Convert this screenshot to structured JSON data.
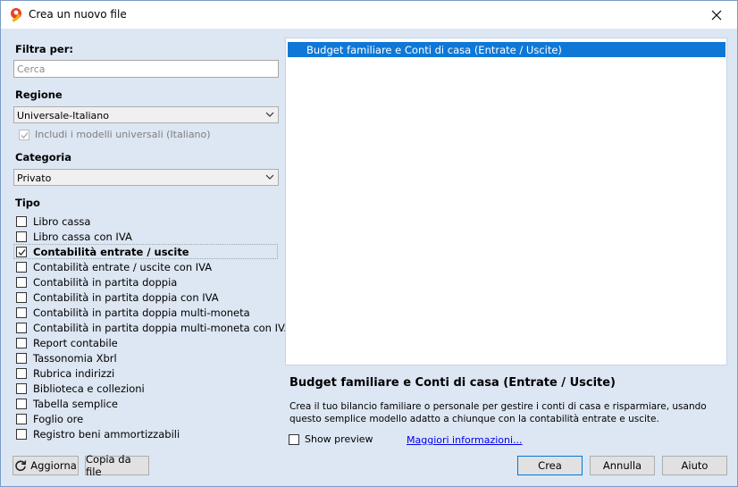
{
  "window": {
    "title": "Crea un nuovo file"
  },
  "filter": {
    "label": "Filtra per:",
    "search_placeholder": "Cerca"
  },
  "region": {
    "label": "Regione",
    "value": "Universale-Italiano",
    "include_universal_label": "Includi i modelli universali (Italiano)",
    "include_universal_checked": true
  },
  "category": {
    "label": "Categoria",
    "value": "Privato"
  },
  "type": {
    "label": "Tipo",
    "items": [
      {
        "label": "Libro cassa",
        "checked": false
      },
      {
        "label": "Libro cassa con IVA",
        "checked": false
      },
      {
        "label": "Contabilità entrate / uscite",
        "checked": true
      },
      {
        "label": "Contabilità entrate / uscite con IVA",
        "checked": false
      },
      {
        "label": "Contabilità in partita doppia",
        "checked": false
      },
      {
        "label": "Contabilità in partita doppia con IVA",
        "checked": false
      },
      {
        "label": "Contabilità in partita doppia multi-moneta",
        "checked": false
      },
      {
        "label": "Contabilità in partita doppia multi-moneta con IVA",
        "checked": false
      },
      {
        "label": "Report contabile",
        "checked": false
      },
      {
        "label": "Tassonomia Xbrl",
        "checked": false
      },
      {
        "label": "Rubrica indirizzi",
        "checked": false
      },
      {
        "label": "Biblioteca e collezioni",
        "checked": false
      },
      {
        "label": "Tabella semplice",
        "checked": false
      },
      {
        "label": "Foglio ore",
        "checked": false
      },
      {
        "label": "Registro beni ammortizzabili",
        "checked": false
      }
    ]
  },
  "templates": {
    "items": [
      "Budget familiare e Conti di casa (Entrate / Uscite)"
    ],
    "selected_index": 0
  },
  "details": {
    "title": "Budget familiare e Conti di casa (Entrate / Uscite)",
    "description": "Crea il tuo bilancio familiare o personale per gestire i conti di casa e risparmiare, usando questo semplice modello adatto a chiunque con la contabilità entrate e uscite.",
    "show_preview_label": "Show preview",
    "show_preview_checked": false,
    "more_info_link": "Maggiori informazioni..."
  },
  "buttons": {
    "refresh": "Aggiorna",
    "copy_from_file": "Copia da file",
    "create": "Crea",
    "cancel": "Annulla",
    "help": "Aiuto"
  },
  "colors": {
    "accent": "#0f78d7",
    "panel_bg": "#dde6f3"
  }
}
